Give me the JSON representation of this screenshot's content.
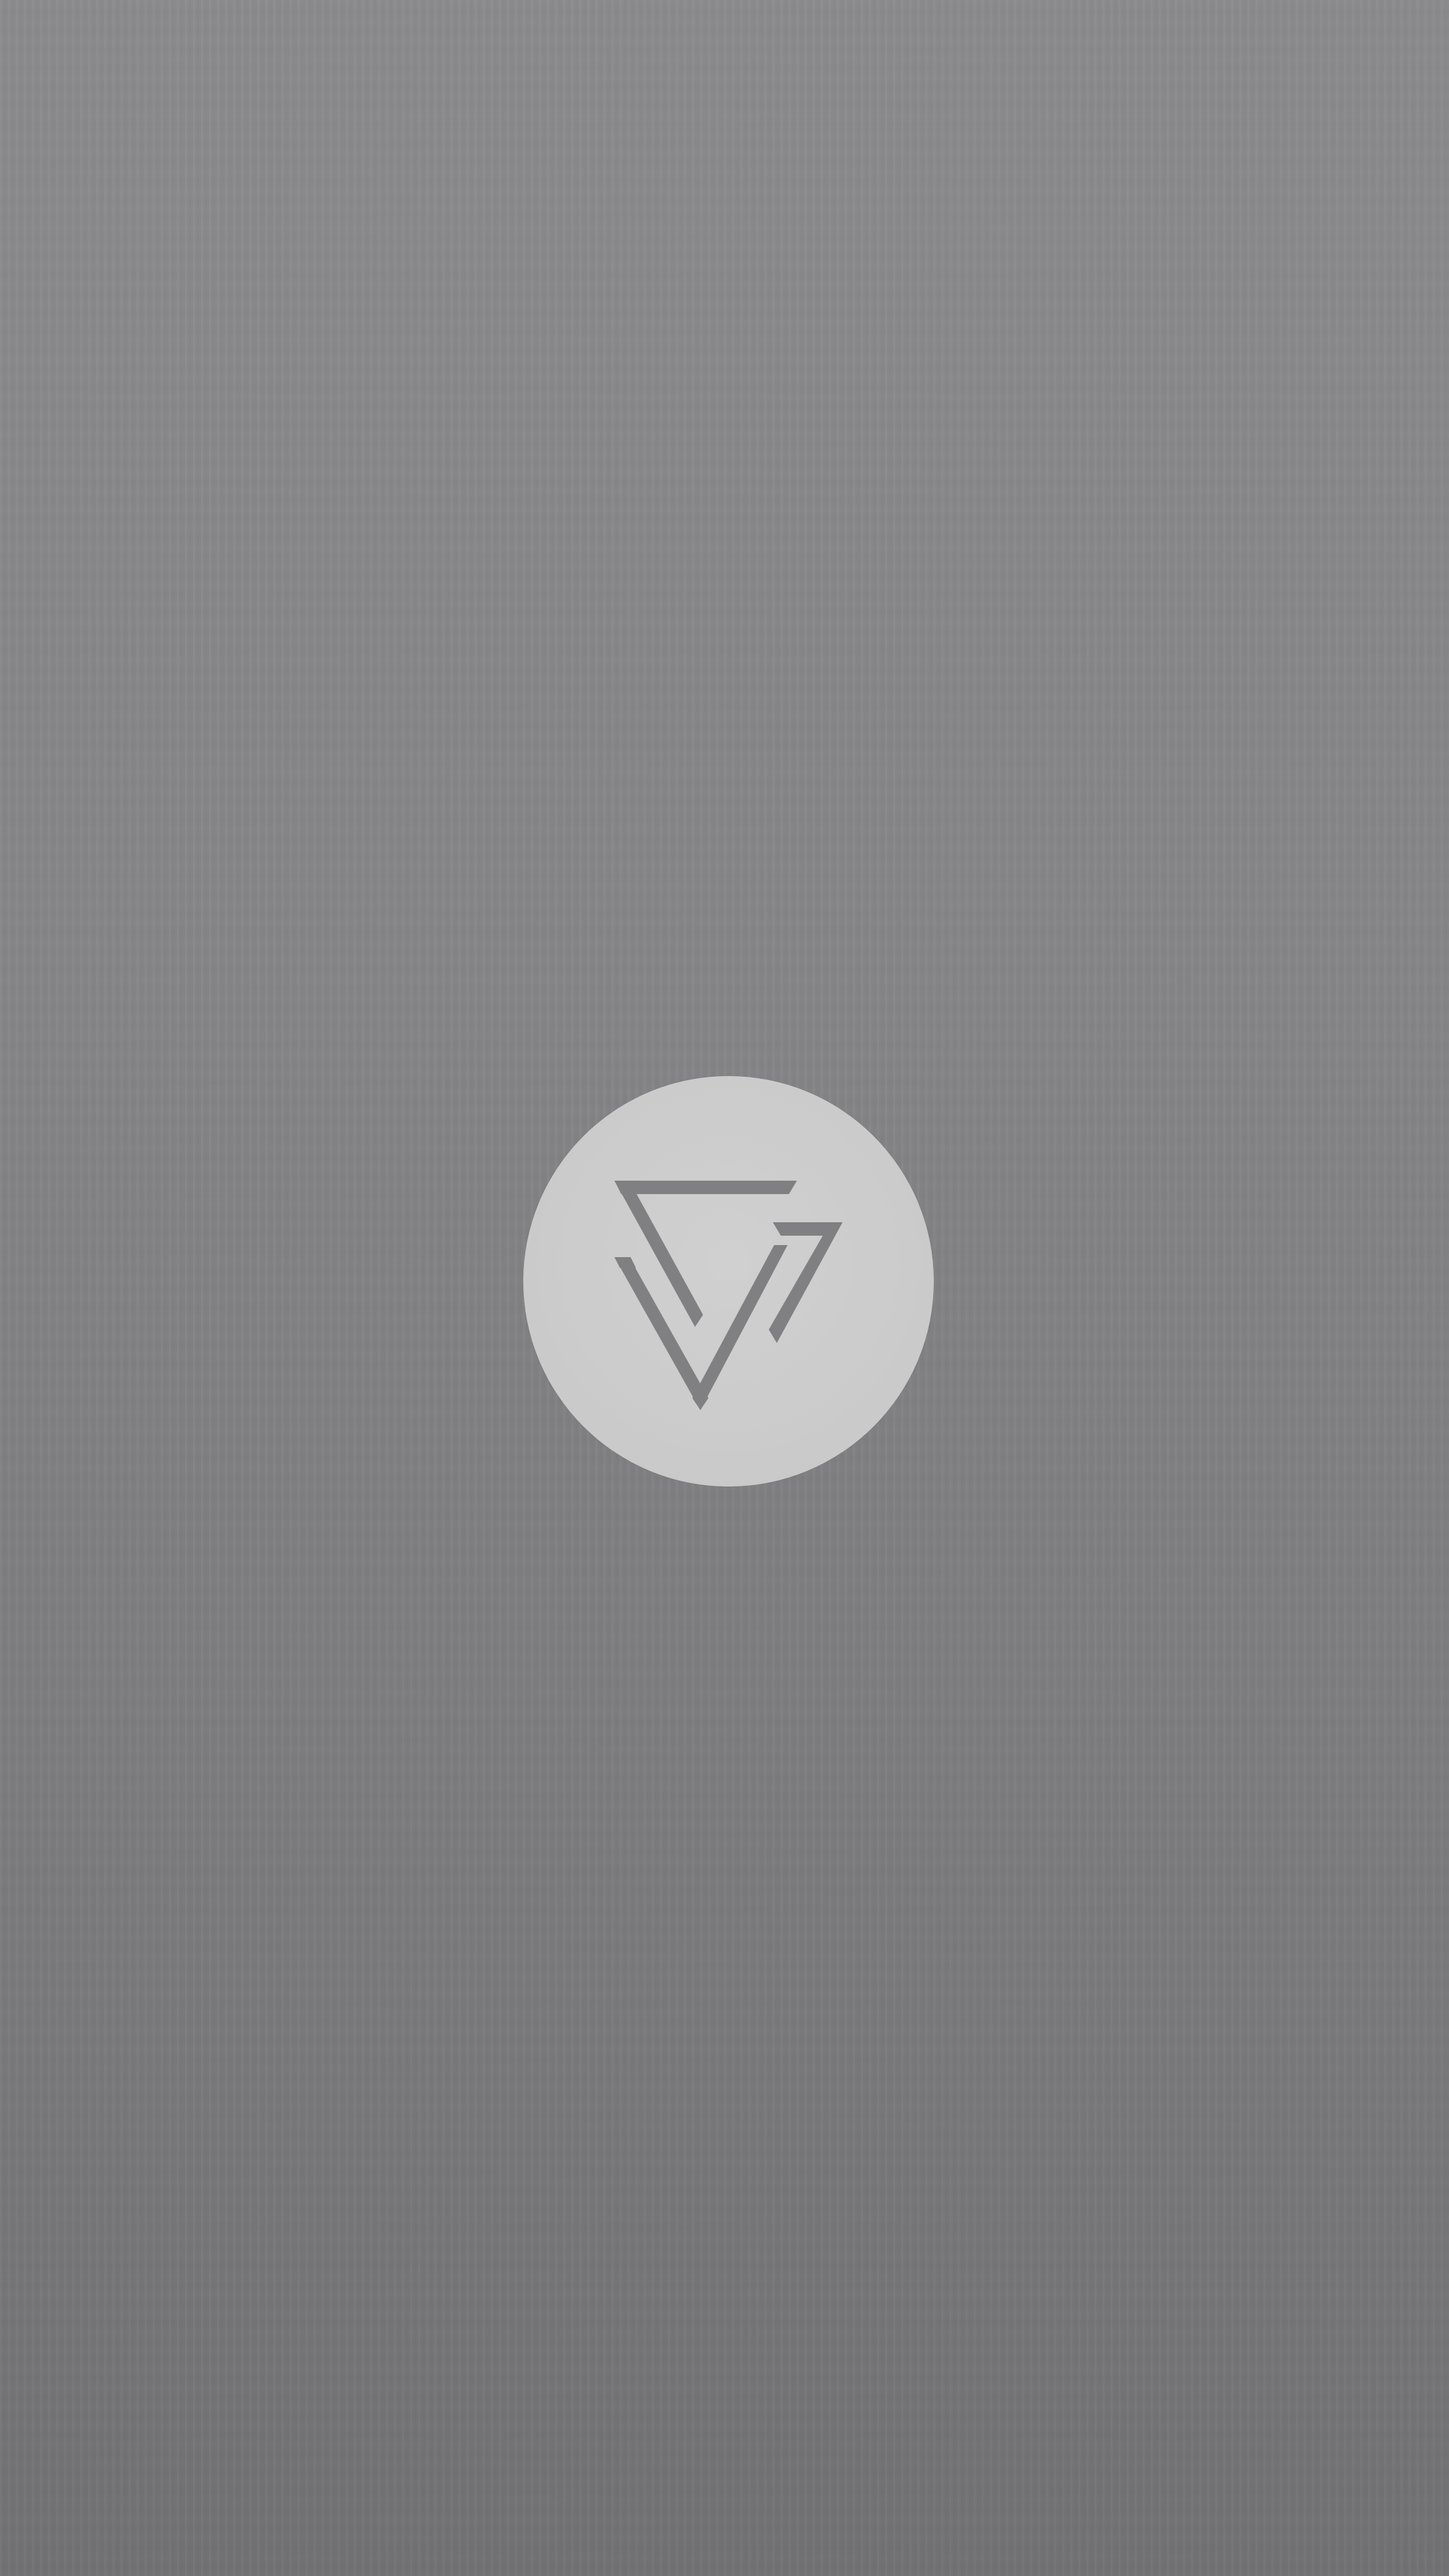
{
  "screen": {
    "type": "splash",
    "background_color": "#858587",
    "logo": {
      "icon": "triangle-knot-logo-icon",
      "badge_color": "#cbcbcb",
      "mark_color": "#808082"
    }
  }
}
